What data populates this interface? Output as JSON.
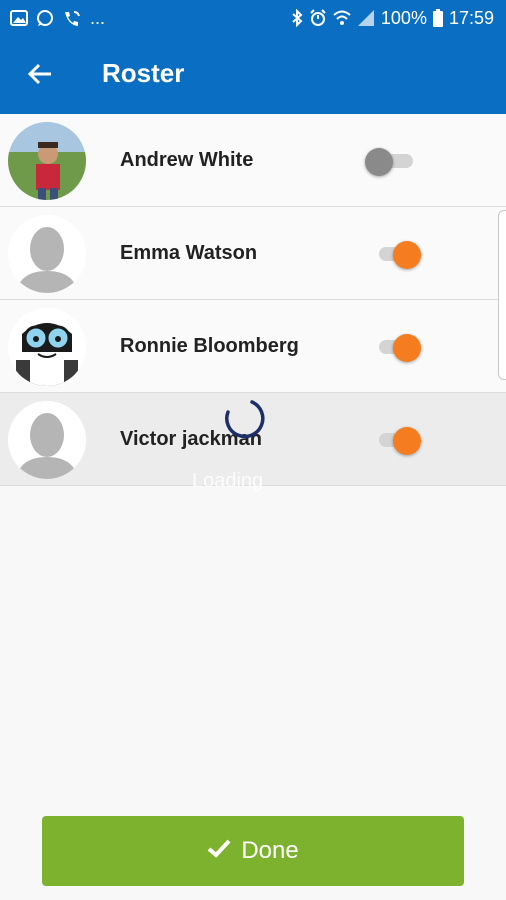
{
  "status_bar": {
    "battery": "100%",
    "time": "17:59",
    "more": "..."
  },
  "header": {
    "title": "Roster",
    "back_icon": "arrow-left-icon"
  },
  "roster": [
    {
      "name": "Andrew White",
      "avatar": "child-photo",
      "toggled": false
    },
    {
      "name": "Emma Watson",
      "avatar": "default-silhouette",
      "toggled": true
    },
    {
      "name": "Ronnie Bloomberg",
      "avatar": "cartoon-character",
      "toggled": true
    },
    {
      "name": "Victor jackman",
      "avatar": "default-silhouette",
      "toggled": true
    }
  ],
  "overlay": {
    "loading_text": "Loading"
  },
  "footer": {
    "done_label": "Done",
    "done_icon": "check-icon"
  },
  "colors": {
    "primary": "#0a6fc2",
    "toggle_on": "#f57c1f",
    "toggle_off": "#8a8a8a",
    "done": "#7cb22e",
    "spinner": "#1c2f6b"
  }
}
